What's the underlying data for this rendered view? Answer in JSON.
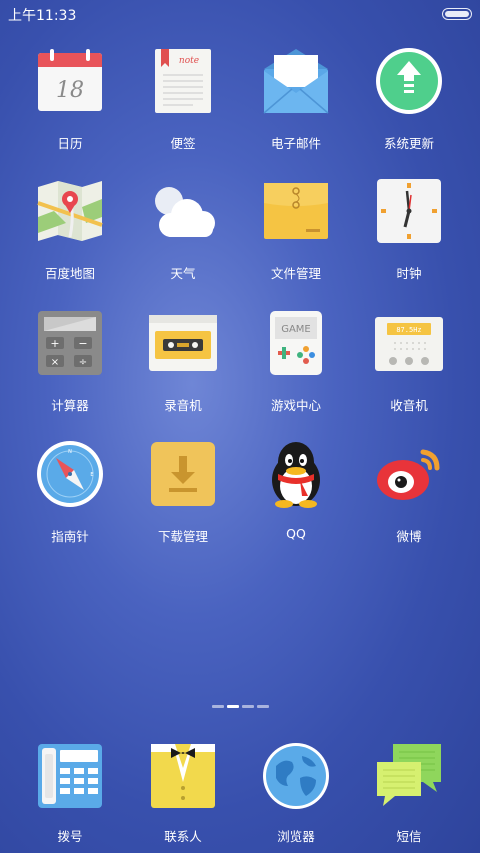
{
  "status_bar": {
    "time": "上午11:33"
  },
  "apps": [
    {
      "id": "calendar",
      "label": "日历",
      "icon": "calendar-icon",
      "calendar_day": "18"
    },
    {
      "id": "notes",
      "label": "便签",
      "icon": "notes-icon",
      "note_word": "note"
    },
    {
      "id": "email",
      "label": "电子邮件",
      "icon": "envelope-icon"
    },
    {
      "id": "updater",
      "label": "系统更新",
      "icon": "update-arrow-icon"
    },
    {
      "id": "maps",
      "label": "百度地图",
      "icon": "map-icon"
    },
    {
      "id": "weather",
      "label": "天气",
      "icon": "cloud-icon"
    },
    {
      "id": "files",
      "label": "文件管理",
      "icon": "folder-envelope-icon"
    },
    {
      "id": "clock",
      "label": "时钟",
      "icon": "clock-icon"
    },
    {
      "id": "calculator",
      "label": "计算器",
      "icon": "calculator-icon"
    },
    {
      "id": "recorder",
      "label": "录音机",
      "icon": "cassette-icon"
    },
    {
      "id": "gamecenter",
      "label": "游戏中心",
      "icon": "gamepad-icon",
      "game_word": "GAME"
    },
    {
      "id": "radio",
      "label": "收音机",
      "icon": "radio-icon",
      "radio_freq": "87.5Hz"
    },
    {
      "id": "compass",
      "label": "指南针",
      "icon": "compass-icon"
    },
    {
      "id": "downloads",
      "label": "下载管理",
      "icon": "download-icon"
    },
    {
      "id": "qq",
      "label": "QQ",
      "icon": "penguin-icon"
    },
    {
      "id": "weibo",
      "label": "微博",
      "icon": "weibo-eye-icon"
    }
  ],
  "pager": {
    "pages": 4,
    "current": 2
  },
  "dock": [
    {
      "id": "dialer",
      "label": "拨号",
      "icon": "telephone-icon"
    },
    {
      "id": "contacts",
      "label": "联系人",
      "icon": "suit-bowtie-icon"
    },
    {
      "id": "browser",
      "label": "浏览器",
      "icon": "globe-icon"
    },
    {
      "id": "messages",
      "label": "短信",
      "icon": "chat-bubbles-icon"
    }
  ],
  "colors": {
    "wallpaper_center": "#6f86d6",
    "wallpaper_edge": "#2e449c",
    "label": "#ffffff"
  }
}
